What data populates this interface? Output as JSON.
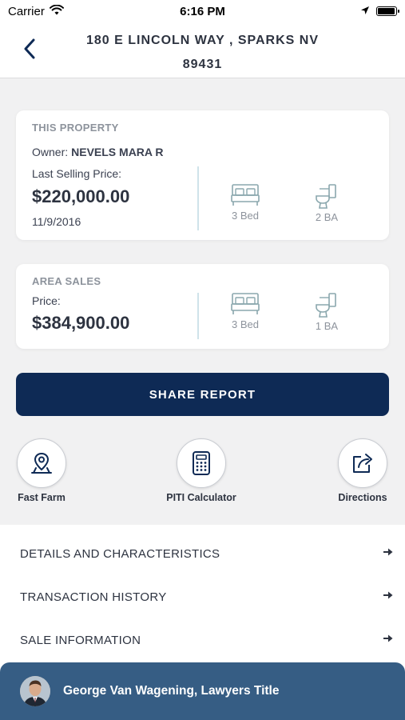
{
  "status_bar": {
    "carrier": "Carrier",
    "time": "6:16 PM",
    "battery_level": 0.95
  },
  "header": {
    "title": "180 E LINCOLN WAY , SPARKS NV 89431"
  },
  "this_property": {
    "section_label": "THIS PROPERTY",
    "owner_label": "Owner:",
    "owner_name": "NEVELS MARA R",
    "price_label": "Last Selling Price:",
    "price": "$220,000.00",
    "date": "11/9/2016",
    "beds": "3 Bed",
    "baths": "2 BA"
  },
  "area_sales": {
    "section_label": "AREA SALES",
    "price_label": "Price:",
    "price": "$384,900.00",
    "beds": "3 Bed",
    "baths": "1 BA"
  },
  "share_button": "SHARE REPORT",
  "quick_actions": [
    {
      "label": "Fast Farm",
      "icon": "map-pin-icon"
    },
    {
      "label": "PITI Calculator",
      "icon": "calculator-icon"
    },
    {
      "label": "Directions",
      "icon": "share-arrow-icon"
    }
  ],
  "info_items": [
    {
      "label": "DETAILS AND CHARACTERISTICS"
    },
    {
      "label": "TRANSACTION HISTORY"
    },
    {
      "label": "SALE INFORMATION"
    }
  ],
  "footer": {
    "name": "George Van Wagening, Lawyers Title"
  },
  "colors": {
    "primary": "#0e2a55",
    "footer": "#365d84",
    "background": "#f1f1f2",
    "icon": "#8aa7ad"
  }
}
